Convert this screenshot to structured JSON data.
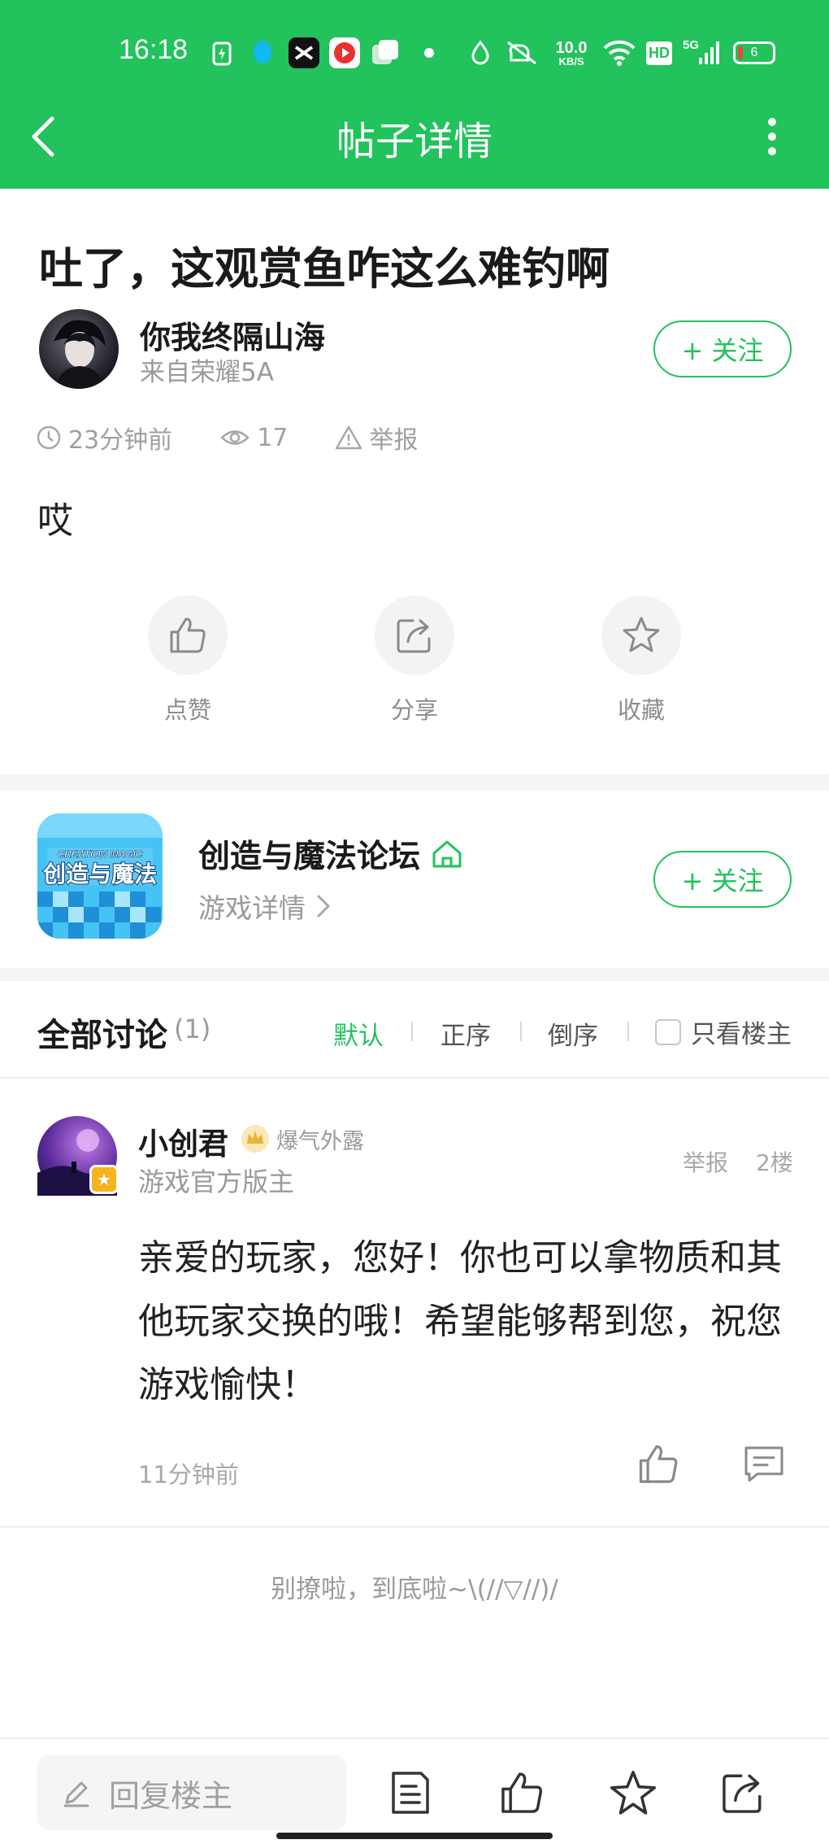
{
  "status_bar": {
    "time": "16:18",
    "net_speed_value": "10.0",
    "net_speed_unit": "KB/S",
    "network_label": "5G",
    "hd_label": "HD",
    "battery_level": "6"
  },
  "app_bar": {
    "title": "帖子详情"
  },
  "post": {
    "title": "吐了，这观赏鱼咋这么难钓啊",
    "author_name": "你我终隔山海",
    "author_source": "来自荣耀5A",
    "follow_label": "+ 关注",
    "time": "23分钟前",
    "views": "17",
    "report_label": "举报",
    "body": "哎",
    "actions": [
      {
        "label": "点赞",
        "icon": "thumbs-up-icon"
      },
      {
        "label": "分享",
        "icon": "share-icon"
      },
      {
        "label": "收藏",
        "icon": "star-icon"
      }
    ]
  },
  "forum": {
    "logo_text_top": "CREATION MAGIC",
    "logo_text_main": "创造与魔法",
    "name": "创造与魔法论坛",
    "detail_label": "游戏详情",
    "follow_label": "+ 关注"
  },
  "discussion": {
    "title": "全部讨论",
    "count": "(1)",
    "sort_default": "默认",
    "sort_asc": "正序",
    "sort_desc": "倒序",
    "only_owner_label": "只看楼主"
  },
  "comments": [
    {
      "name": "小创君",
      "rank": "爆气外露",
      "role": "游戏官方版主",
      "report_label": "举报",
      "floor": "2楼",
      "body": "亲爱的玩家，您好！你也可以拿物质和其他玩家交换的哦！希望能够帮到您，祝您游戏愉快！",
      "time": "11分钟前"
    }
  ],
  "end_text": "别撩啦，到底啦~\\(//▽//)/",
  "bottom_bar": {
    "reply_placeholder": "回复楼主"
  },
  "colors": {
    "accent": "#22c25c",
    "muted_text": "#9a9a9a",
    "gold_badge": "#f5b31e"
  }
}
